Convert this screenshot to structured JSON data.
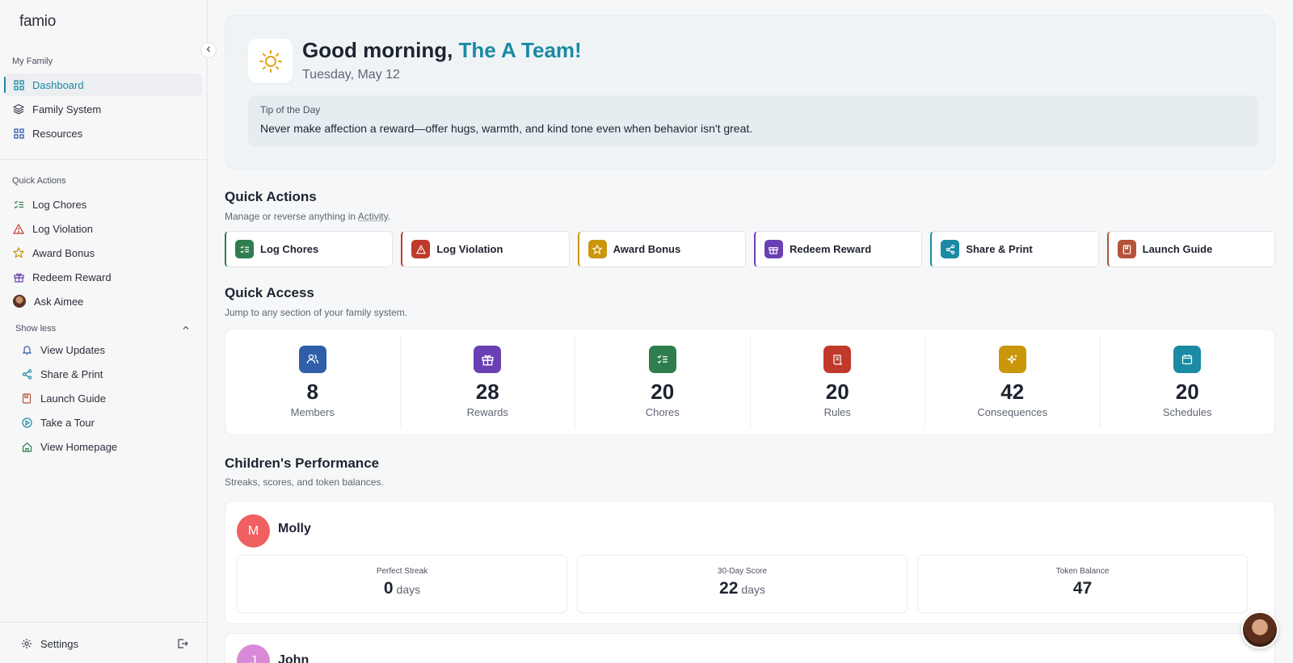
{
  "app": {
    "logo": "famio"
  },
  "sidebar": {
    "my_family_label": "My Family",
    "nav": [
      {
        "label": "Dashboard",
        "icon": "grid-icon",
        "active": true
      },
      {
        "label": "Family System",
        "icon": "layers-icon"
      },
      {
        "label": "Resources",
        "icon": "grid-icon"
      }
    ],
    "quick_actions_label": "Quick Actions",
    "quick": [
      {
        "label": "Log Chores",
        "icon": "checklist-icon"
      },
      {
        "label": "Log Violation",
        "icon": "warning-icon"
      },
      {
        "label": "Award Bonus",
        "icon": "star-icon"
      },
      {
        "label": "Redeem Reward",
        "icon": "gift-icon"
      },
      {
        "label": "Ask Aimee",
        "icon": "avatar"
      }
    ],
    "show_less": "Show less",
    "more": [
      {
        "label": "View Updates",
        "icon": "bell-icon"
      },
      {
        "label": "Share & Print",
        "icon": "share-icon"
      },
      {
        "label": "Launch Guide",
        "icon": "book-icon"
      },
      {
        "label": "Take a Tour",
        "icon": "play-icon"
      },
      {
        "label": "View Homepage",
        "icon": "home-icon"
      }
    ],
    "settings": "Settings"
  },
  "hero": {
    "greeting": "Good morning, ",
    "team": "The A Team!",
    "date": "Tuesday, May 12",
    "tip_label": "Tip of the Day",
    "tip_text": "Never make affection a reward—offer hugs, warmth, and kind tone even when behavior isn't great."
  },
  "quick_actions": {
    "title": "Quick Actions",
    "subtitle_prefix": "Manage or reverse anything in ",
    "subtitle_link": "Activity",
    "subtitle_suffix": ".",
    "buttons": [
      {
        "label": "Log Chores",
        "color": "#2e7d4f"
      },
      {
        "label": "Log Violation",
        "color": "#c0392b"
      },
      {
        "label": "Award Bonus",
        "color": "#c9960c"
      },
      {
        "label": "Redeem Reward",
        "color": "#6a3fb3"
      },
      {
        "label": "Share & Print",
        "color": "#1b8aa3"
      },
      {
        "label": "Launch Guide",
        "color": "#b5533a"
      }
    ]
  },
  "quick_access": {
    "title": "Quick Access",
    "subtitle": "Jump to any section of your family system.",
    "cells": [
      {
        "value": "8",
        "label": "Members",
        "color": "#2f5fa8"
      },
      {
        "value": "28",
        "label": "Rewards",
        "color": "#6a3fb3"
      },
      {
        "value": "20",
        "label": "Chores",
        "color": "#2e7d4f"
      },
      {
        "value": "20",
        "label": "Rules",
        "color": "#c0392b"
      },
      {
        "value": "42",
        "label": "Consequences",
        "color": "#c9960c"
      },
      {
        "value": "20",
        "label": "Schedules",
        "color": "#1b8aa3"
      }
    ]
  },
  "performance": {
    "title": "Children's Performance",
    "subtitle": "Streaks, scores, and token balances.",
    "children": [
      {
        "initial": "M",
        "name": "Molly",
        "color": "#f06060",
        "streak_label": "Perfect Streak",
        "streak": "0",
        "streak_unit": "days",
        "score_label": "30-Day Score",
        "score": "22",
        "score_unit": "days",
        "tokens_label": "Token Balance",
        "tokens": "47"
      },
      {
        "initial": "J",
        "name": "John",
        "color": "#d98ad6"
      }
    ]
  }
}
